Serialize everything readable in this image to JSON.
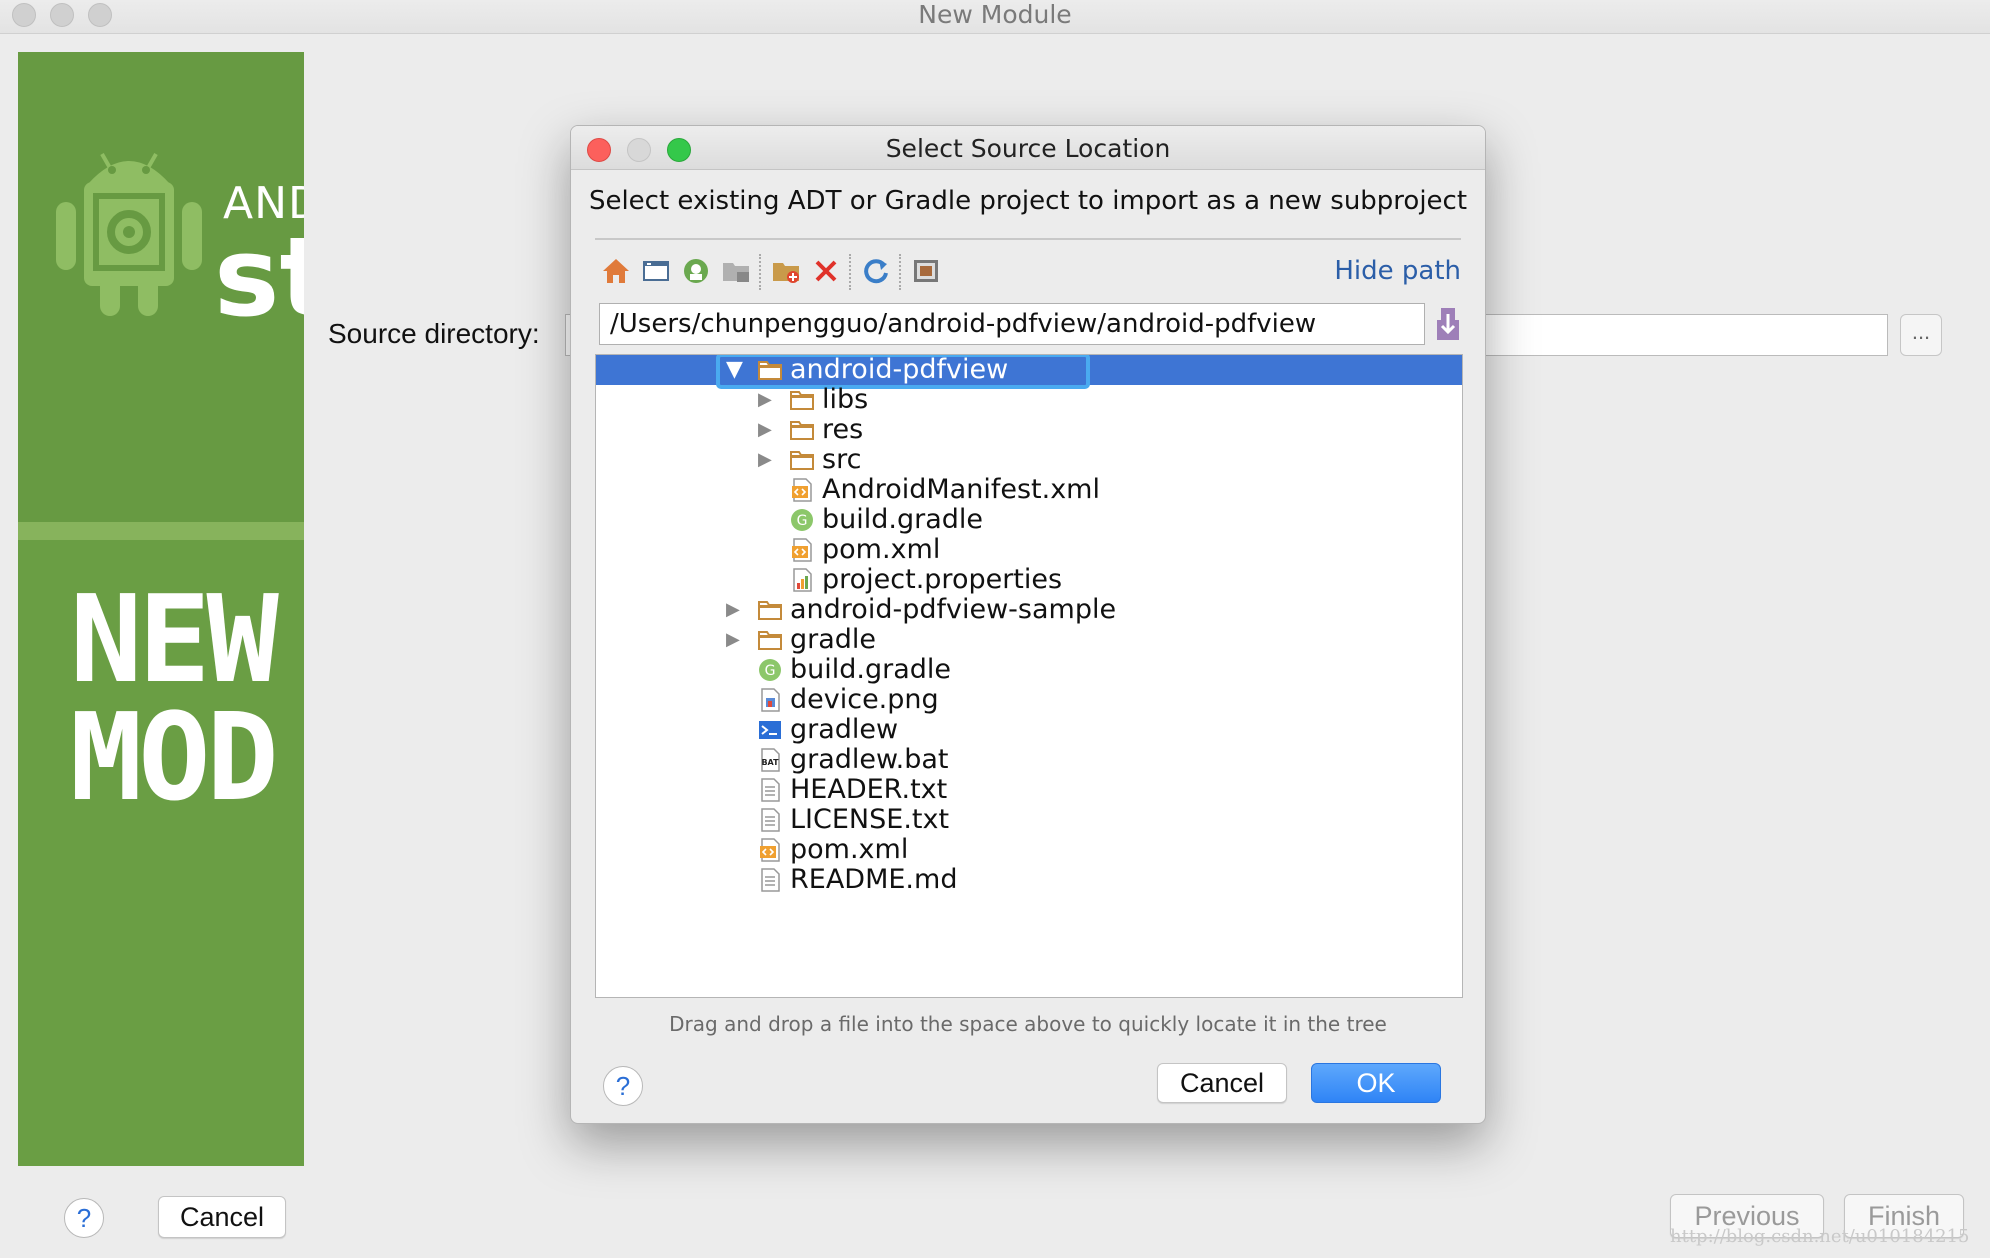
{
  "window": {
    "title": "New Module"
  },
  "banner": {
    "brand_small": "ANDR",
    "brand_big": "st",
    "heading_line1": "NEW",
    "heading_line2": "MOD"
  },
  "wizard": {
    "source_label": "Source directory:",
    "browse_label": "...",
    "help_label": "?",
    "cancel_label": "Cancel",
    "previous_label": "Previous",
    "finish_label": "Finish",
    "watermark": "http://blog.csdn.net/u010184215"
  },
  "dialog": {
    "title": "Select Source Location",
    "description": "Select existing ADT or Gradle project to import as a new subproject",
    "hide_path_label": "Hide path",
    "path_value": "/Users/chunpengguo/android-pdfview/android-pdfview",
    "hint": "Drag and drop a file into the space above to quickly locate it in the tree",
    "help_label": "?",
    "cancel_label": "Cancel",
    "ok_label": "OK",
    "toolbar_icons": [
      "home-icon",
      "desktop-icon",
      "project-icon",
      "module-folder-icon",
      "new-folder-icon",
      "delete-icon",
      "refresh-icon",
      "show-hidden-icon"
    ],
    "tree": [
      {
        "label": "android-pdfview",
        "icon": "folder",
        "depth": 0,
        "expandable": true,
        "expanded": true,
        "selected": true
      },
      {
        "label": "libs",
        "icon": "folder",
        "depth": 1,
        "expandable": true
      },
      {
        "label": "res",
        "icon": "folder",
        "depth": 1,
        "expandable": true
      },
      {
        "label": "src",
        "icon": "folder",
        "depth": 1,
        "expandable": true
      },
      {
        "label": "AndroidManifest.xml",
        "icon": "xml",
        "depth": 1
      },
      {
        "label": "build.gradle",
        "icon": "gradle",
        "depth": 1
      },
      {
        "label": "pom.xml",
        "icon": "xml",
        "depth": 1
      },
      {
        "label": "project.properties",
        "icon": "properties",
        "depth": 1
      },
      {
        "label": "android-pdfview-sample",
        "icon": "folder",
        "depth": 0,
        "expandable": true
      },
      {
        "label": "gradle",
        "icon": "folder",
        "depth": 0,
        "expandable": true
      },
      {
        "label": "build.gradle",
        "icon": "gradle",
        "depth": 0
      },
      {
        "label": "device.png",
        "icon": "image",
        "depth": 0
      },
      {
        "label": "gradlew",
        "icon": "terminal",
        "depth": 0
      },
      {
        "label": "gradlew.bat",
        "icon": "bat",
        "depth": 0
      },
      {
        "label": "HEADER.txt",
        "icon": "text",
        "depth": 0
      },
      {
        "label": "LICENSE.txt",
        "icon": "text",
        "depth": 0
      },
      {
        "label": "pom.xml",
        "icon": "xml",
        "depth": 0
      },
      {
        "label": "README.md",
        "icon": "text",
        "depth": 0
      }
    ]
  },
  "colors": {
    "accent": "#3e75d4",
    "banner_green": "#6a9e44",
    "ok_blue": "#2f84f6",
    "focus": "#4aaaf0"
  }
}
